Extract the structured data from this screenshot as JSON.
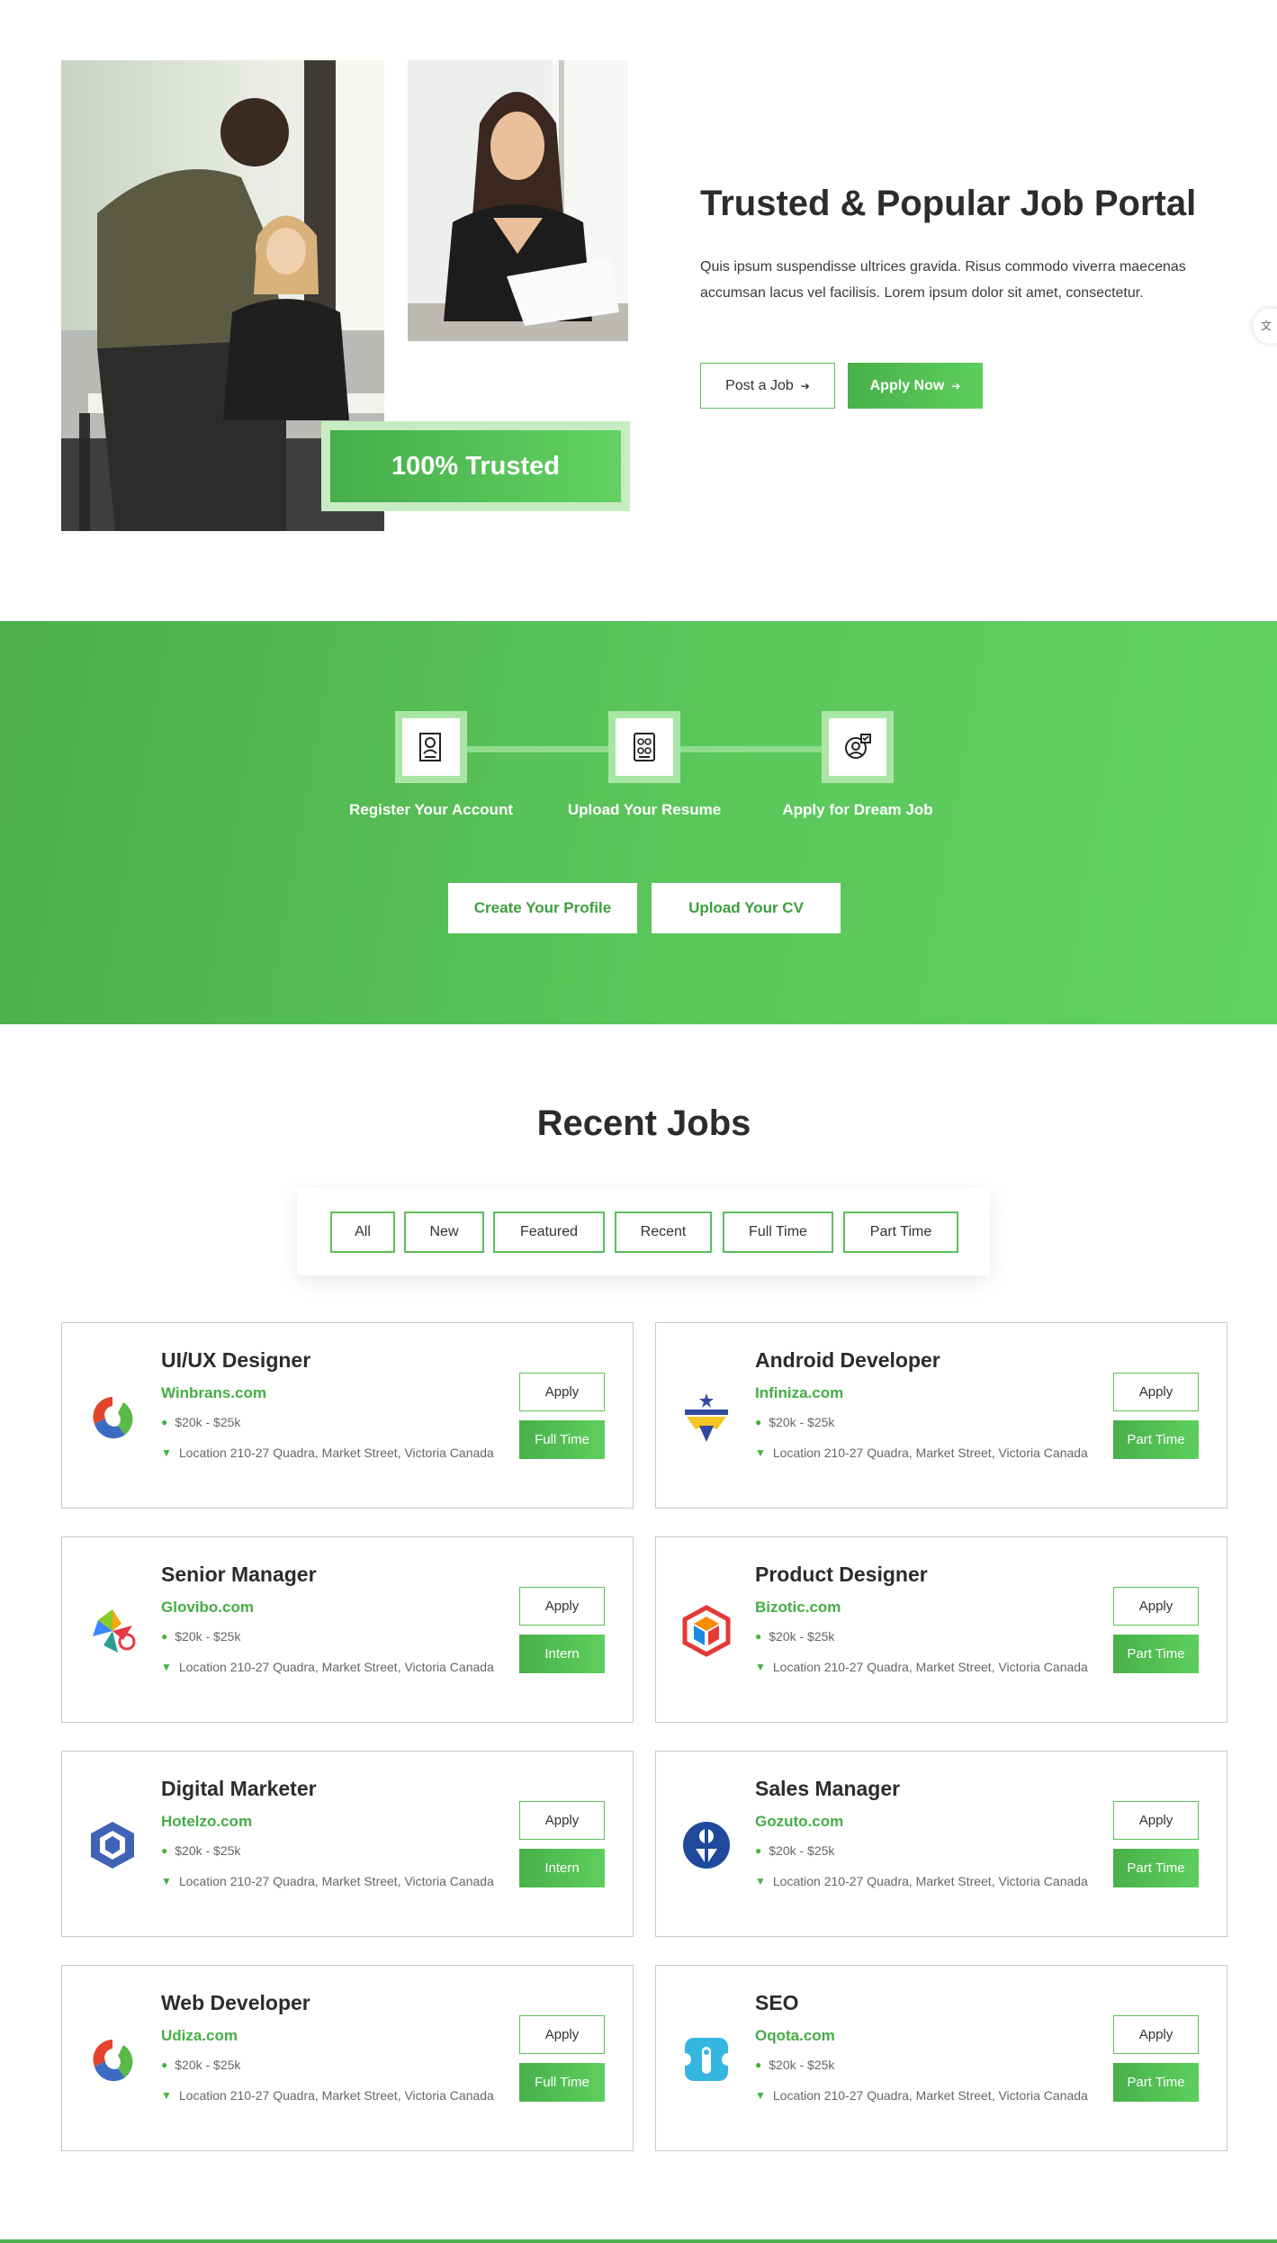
{
  "hero": {
    "title": "Trusted & Popular Job Portal",
    "description": "Quis ipsum suspendisse ultrices gravida. Risus commodo viverra maecenas accumsan lacus vel facilisis. Lorem ipsum dolor sit amet, consectetur.",
    "trusted_badge": "100% Trusted",
    "post_job_label": "Post a Job",
    "apply_now_label": "Apply Now",
    "arrow": "➔"
  },
  "steps": {
    "items": [
      {
        "label": "Register Your Account",
        "icon": "resume-document-icon"
      },
      {
        "label": "Upload Your Resume",
        "icon": "resume-upload-icon"
      },
      {
        "label": "Apply for Dream Job",
        "icon": "dream-job-icon"
      }
    ],
    "create_profile_label": "Create Your Profile",
    "upload_cv_label": "Upload Your CV"
  },
  "recent_jobs": {
    "title": "Recent Jobs",
    "filters": [
      "All",
      "New",
      "Featured",
      "Recent",
      "Full Time",
      "Part Time"
    ],
    "apply_label": "Apply",
    "jobs": [
      {
        "title": "UI/UX Designer",
        "company": "Winbrans.com",
        "salary": "$20k - $25k",
        "location": "Location 210-27 Quadra, Market Street, Victoria Canada",
        "type": "Full Time",
        "logo": "swirl-logo-icon"
      },
      {
        "title": "Android Developer",
        "company": "Infiniza.com",
        "salary": "$20k - $25k",
        "location": "Location 210-27 Quadra, Market Street, Victoria Canada",
        "type": "Part Time",
        "logo": "star-figure-logo-icon"
      },
      {
        "title": "Senior Manager",
        "company": "Glovibo.com",
        "salary": "$20k - $25k",
        "location": "Location 210-27 Quadra, Market Street, Victoria Canada",
        "type": "Intern",
        "logo": "pinwheel-logo-icon"
      },
      {
        "title": "Product Designer",
        "company": "Bizotic.com",
        "salary": "$20k - $25k",
        "location": "Location 210-27 Quadra, Market Street, Victoria Canada",
        "type": "Part Time",
        "logo": "cube-logo-icon"
      },
      {
        "title": "Digital Marketer",
        "company": "Hotelzo.com",
        "salary": "$20k - $25k",
        "location": "Location 210-27 Quadra, Market Street, Victoria Canada",
        "type": "Intern",
        "logo": "hexagon-logo-icon"
      },
      {
        "title": "Sales Manager",
        "company": "Gozuto.com",
        "salary": "$20k - $25k",
        "location": "Location 210-27 Quadra, Market Street, Victoria Canada",
        "type": "Part Time",
        "logo": "person-circle-logo-icon"
      },
      {
        "title": "Web Developer",
        "company": "Udiza.com",
        "salary": "$20k - $25k",
        "location": "Location 210-27 Quadra, Market Street, Victoria Canada",
        "type": "Full Time",
        "logo": "swirl-logo-icon"
      },
      {
        "title": "SEO",
        "company": "Oqota.com",
        "salary": "$20k - $25k",
        "location": "Location 210-27 Quadra, Market Street, Victoria Canada",
        "type": "Part Time",
        "logo": "puzzle-logo-icon"
      }
    ]
  },
  "colors": {
    "accent": "#4caf50",
    "accent_light": "#63d063",
    "text_dark": "#2c2c2c"
  }
}
